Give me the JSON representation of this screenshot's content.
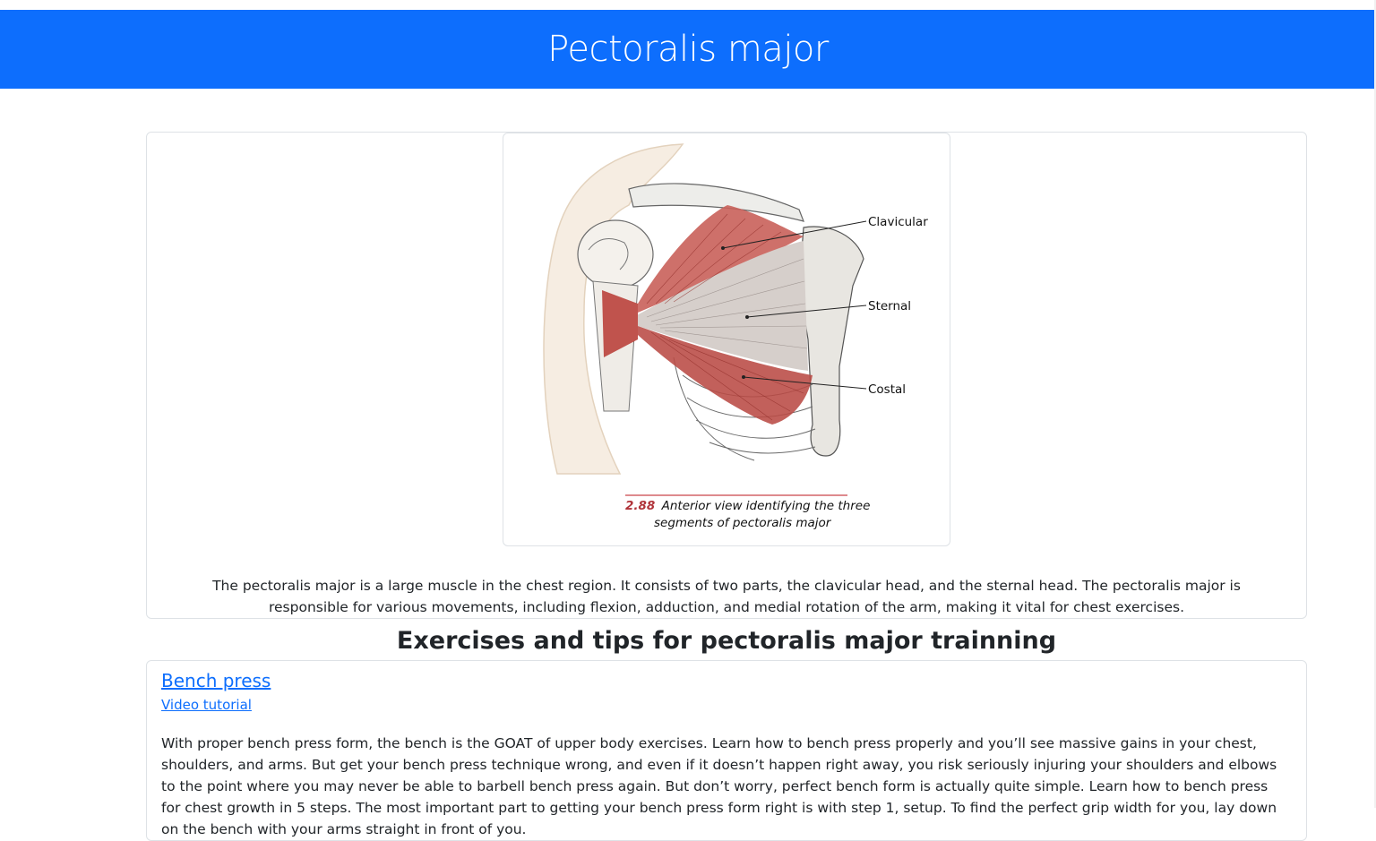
{
  "header": {
    "title": "Pectoralis major"
  },
  "figure": {
    "labels": [
      "Clavicular",
      "Sternal",
      "Costal"
    ],
    "caption_number": "2.88",
    "caption_line1": "Anterior view identifying the three",
    "caption_line2": "segments of pectoralis major"
  },
  "muscle": {
    "description": "The pectoralis major is a large muscle in the chest region. It consists of two parts, the clavicular head, and the sternal head. The pectoralis major is responsible for various movements, including flexion, adduction, and medial rotation of the arm, making it vital for chest exercises."
  },
  "exercises_section": {
    "title": "Exercises and tips for pectoralis major trainning"
  },
  "exercises": [
    {
      "name": "Bench press",
      "link_label": "Video tutorial",
      "text": "With proper bench press form, the bench is the GOAT of upper body exercises. Learn how to bench press properly and you’ll see massive gains in your chest, shoulders, and arms. But get your bench press technique wrong, and even if it doesn’t happen right away, you risk seriously injuring your shoulders and elbows to the point where you may never be able to barbell bench press again. But don’t worry, perfect bench form is actually quite simple. Learn how to bench press for chest growth in 5 steps. The most important part to getting your bench press form right is with step 1, setup. To find the perfect grip width for you, lay down on the bench with your arms straight in front of you."
    }
  ],
  "colors": {
    "header_bg": "#0d6efd",
    "link": "#0d6efd",
    "muscle_red": "#b5443f"
  }
}
